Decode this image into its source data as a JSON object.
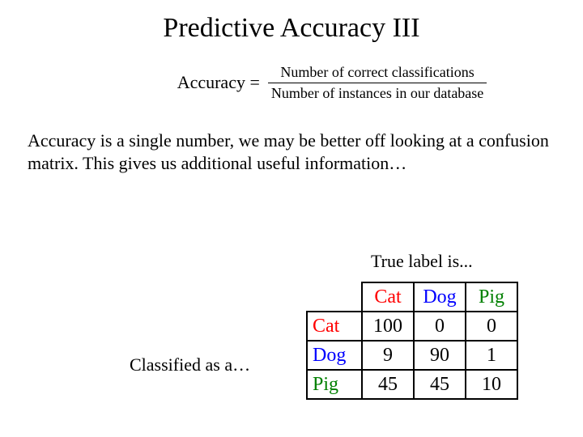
{
  "title": "Predictive Accuracy III",
  "formula": {
    "lhs": "Accuracy =",
    "numerator": "Number of correct classifications",
    "denominator": "Number of instances in our database"
  },
  "body": "Accuracy is a single number, we may be better off looking at a confusion matrix. This gives us additional useful information…",
  "labels": {
    "true": "True label is...",
    "classified": "Classified as a…"
  },
  "chart_data": {
    "type": "table",
    "title": "Confusion matrix",
    "col_headers": [
      "Cat",
      "Dog",
      "Pig"
    ],
    "row_headers": [
      "Cat",
      "Dog",
      "Pig"
    ],
    "colors": {
      "Cat": "#ff0000",
      "Dog": "#0000ff",
      "Pig": "#008000"
    },
    "values": [
      [
        100,
        0,
        0
      ],
      [
        9,
        90,
        1
      ],
      [
        45,
        45,
        10
      ]
    ]
  }
}
